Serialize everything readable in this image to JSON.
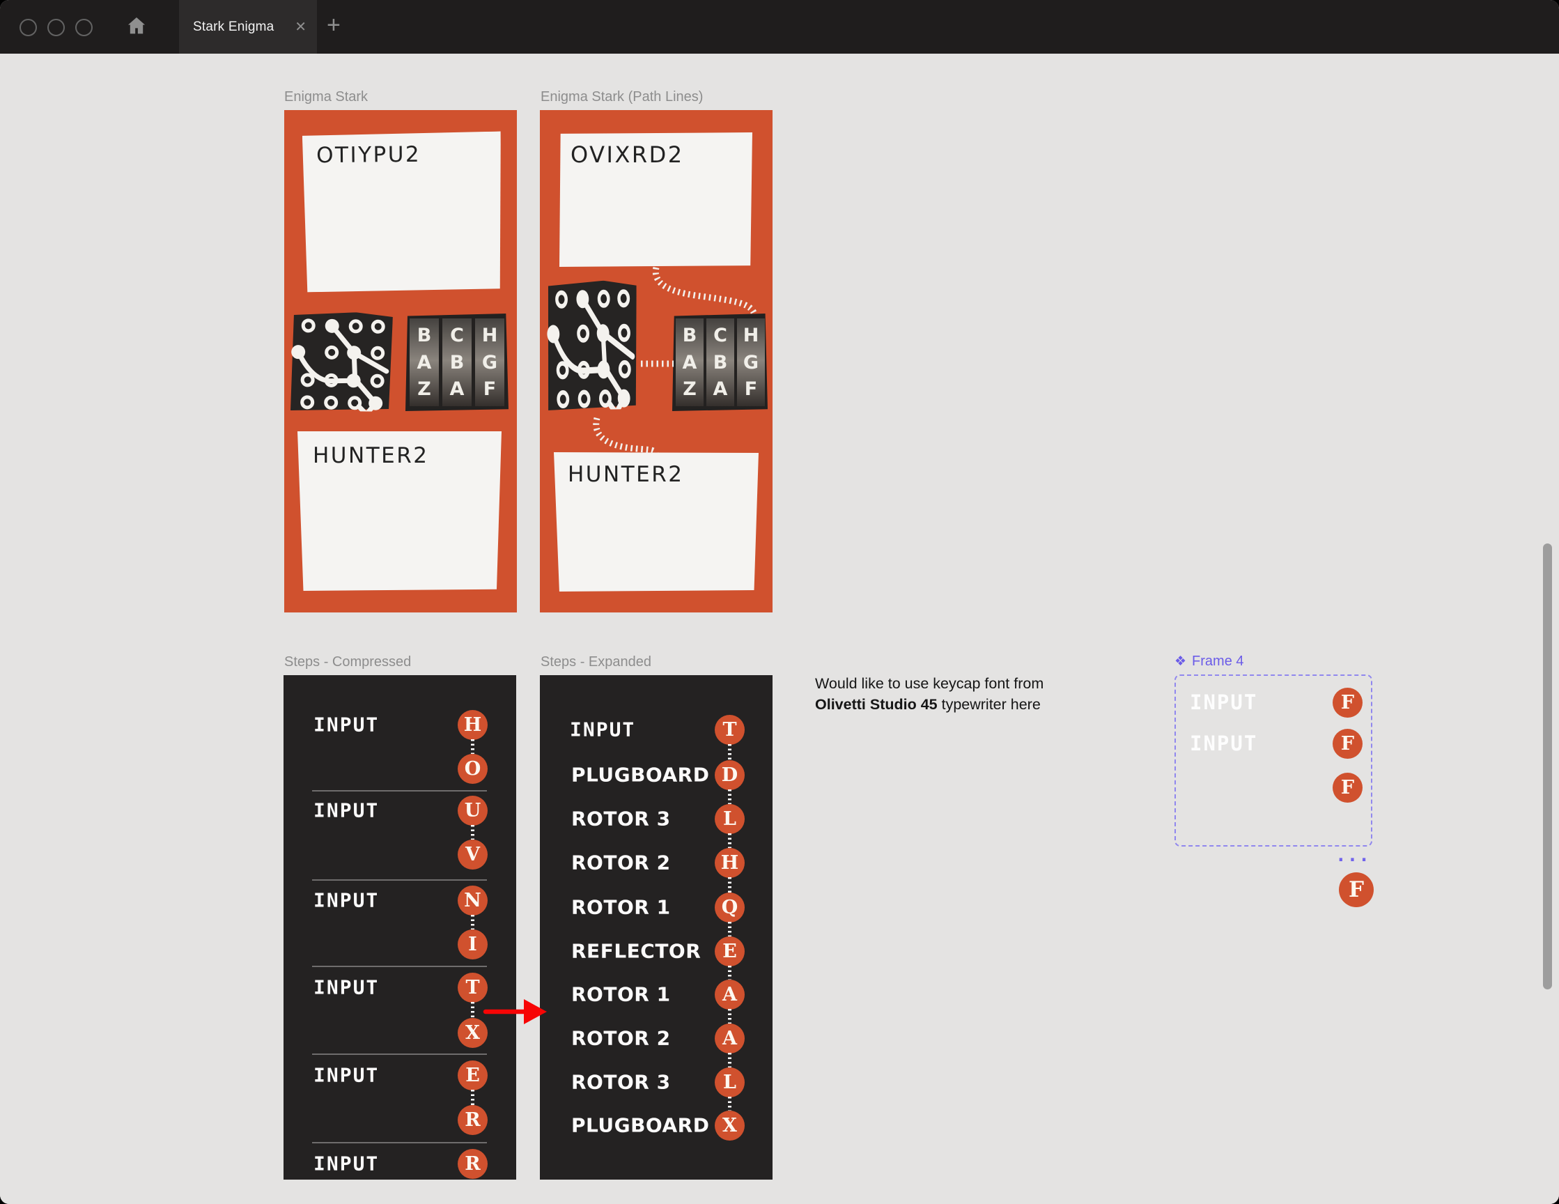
{
  "titlebar": {
    "tab_title": "Stark Enigma",
    "close_label": "✕",
    "new_tab_label": "+"
  },
  "colors": {
    "accent_orange": "#d0512e",
    "panel_dark": "#242222",
    "component_purple": "#6b5ce8",
    "arrow_red": "#f70505",
    "canvas_gray": "#e4e3e2"
  },
  "frame_enigma": {
    "label": "Enigma Stark",
    "top_paper": "OTIYPU2",
    "bottom_paper": "HUNTER2"
  },
  "frame_enigma_paths": {
    "label": "Enigma Stark (Path Lines)",
    "top_paper": "OVIXRD2",
    "bottom_paper": "HUNTER2"
  },
  "rotor_columns": [
    [
      "B",
      "A",
      "Z"
    ],
    [
      "C",
      "B",
      "A"
    ],
    [
      "H",
      "G",
      "F"
    ]
  ],
  "steps_compressed": {
    "label": "Steps - Compressed",
    "rows": [
      {
        "label": "INPUT",
        "letters": [
          "H",
          "O"
        ]
      },
      {
        "label": "INPUT",
        "letters": [
          "U",
          "V"
        ]
      },
      {
        "label": "INPUT",
        "letters": [
          "N",
          "I"
        ]
      },
      {
        "label": "INPUT",
        "letters": [
          "T",
          "X"
        ]
      },
      {
        "label": "INPUT",
        "letters": [
          "E",
          "R"
        ]
      },
      {
        "label": "INPUT",
        "letters": [
          "R"
        ]
      }
    ]
  },
  "steps_expanded": {
    "label": "Steps - Expanded",
    "rows": [
      {
        "label": "INPUT",
        "letter": "T"
      },
      {
        "label": "PLUGBOARD",
        "letter": "D"
      },
      {
        "label": "ROTOR 3",
        "letter": "L"
      },
      {
        "label": "ROTOR 2",
        "letter": "H"
      },
      {
        "label": "ROTOR 1",
        "letter": "Q"
      },
      {
        "label": "REFLECTOR",
        "letter": "E"
      },
      {
        "label": "ROTOR 1",
        "letter": "A"
      },
      {
        "label": "ROTOR 2",
        "letter": "A"
      },
      {
        "label": "ROTOR 3",
        "letter": "L"
      },
      {
        "label": "PLUGBOARD",
        "letter": "X"
      }
    ]
  },
  "note": {
    "line1": "Would like to use keycap font from",
    "bold": "Olivetti Studio 45",
    "after_bold": " typewriter here"
  },
  "frame4": {
    "icon": "❖",
    "label": "Frame 4",
    "rows": [
      {
        "label": "INPUT",
        "letter": "F"
      },
      {
        "label": "INPUT",
        "letter": "F"
      },
      {
        "label": "",
        "letter": "F"
      }
    ],
    "ellipsis": "...",
    "floating_letter": "F"
  }
}
